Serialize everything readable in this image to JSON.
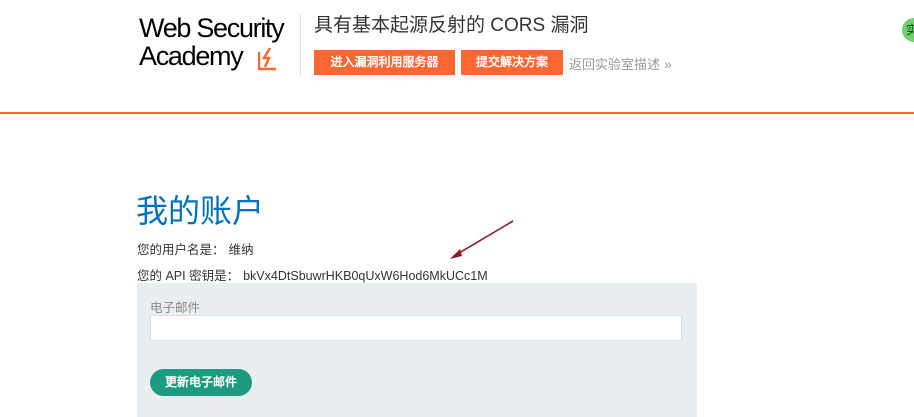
{
  "header": {
    "logo_line1": "Web Security",
    "logo_line2": "Academy",
    "lab_title": "具有基本起源反射的 CORS 漏洞",
    "exploit_button": "进入漏洞利用服务器",
    "submit_button": "提交解决方案",
    "back_link": "返回实验室描述",
    "back_link_chevron": "»",
    "badge_text": "实",
    "accent_color": "#ff6633"
  },
  "main": {
    "title": "我的账户",
    "username_label": "您的用户名是：",
    "username_value": "维纳",
    "api_label": "您的 API 密钥是：",
    "api_value": "bkVx4DtSbuwrHKB0qUxW6Hod6MkUCc1M",
    "title_color": "#0071bc",
    "annotation_arrow_color": "#8b1a2b"
  },
  "email_form": {
    "label": "电子邮件",
    "value": "",
    "placeholder": "",
    "submit_button": "更新电子邮件",
    "button_color": "#1d9b80"
  }
}
